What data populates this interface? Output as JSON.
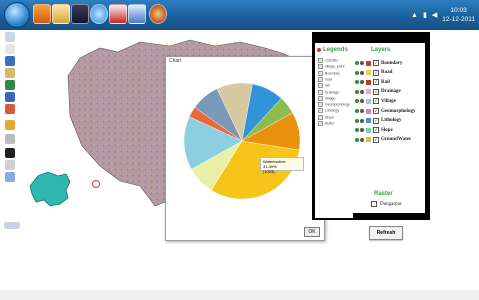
{
  "taskbar": {
    "icons": [
      "start-orb",
      "media-player",
      "folder",
      "app-fx",
      "browser",
      "pdf-reader",
      "document",
      "game"
    ],
    "clock_time": "10:03",
    "clock_date": "12-12-2011"
  },
  "pie_window": {
    "title": "Chart",
    "tooltip_line1": "Waterbodies: 31.39%",
    "tooltip_line2": "(1003)",
    "ok_label": "OK"
  },
  "legend_panel": {
    "title": "Legends",
    "items": [
      "cl Buffer",
      "village_point",
      "Boundary",
      "road",
      "rail",
      "Drainage",
      "Village",
      "Geomorphology",
      "Lithology",
      "Slope",
      "Buffer"
    ]
  },
  "layers_panel": {
    "title": "Layers",
    "layers": [
      {
        "name": "Boundary",
        "color": "#d23a2a",
        "checked": true
      },
      {
        "name": "Road",
        "color": "#e8d24a",
        "checked": true
      },
      {
        "name": "Rail",
        "color": "#c0392b",
        "checked": true
      },
      {
        "name": "Drainage",
        "color": "#e2b0b8",
        "checked": true
      },
      {
        "name": "Village",
        "color": "#9ec6e8",
        "checked": true
      },
      {
        "name": "Geomorphology",
        "color": "#b68fd6",
        "checked": true
      },
      {
        "name": "Lithology",
        "color": "#4a8fd4",
        "checked": true
      },
      {
        "name": "Slope",
        "color": "#7ed0a0",
        "checked": true
      },
      {
        "name": "GroundWater",
        "color": "#f0b24a",
        "checked": true
      }
    ],
    "raster_title": "Raster",
    "raster_item": "Dungarpur",
    "refresh_label": "Refresh"
  },
  "chart_data": {
    "type": "pie",
    "slices": [
      {
        "label": "Waterbodies",
        "value": 31.39,
        "color": "#f5c518"
      },
      {
        "label": "",
        "value": 8,
        "color": "#e8f0a8"
      },
      {
        "label": "",
        "value": 15,
        "color": "#8ccfe0"
      },
      {
        "label": "",
        "value": 3,
        "color": "#e86a3a"
      },
      {
        "label": "",
        "value": 8,
        "color": "#7a98b8"
      },
      {
        "label": "",
        "value": 10,
        "color": "#d8c8a0"
      },
      {
        "label": "",
        "value": 9,
        "color": "#2f94d8"
      },
      {
        "label": "",
        "value": 5,
        "color": "#8cbc4a"
      },
      {
        "label": "",
        "value": 10.61,
        "color": "#e8920e"
      }
    ]
  }
}
